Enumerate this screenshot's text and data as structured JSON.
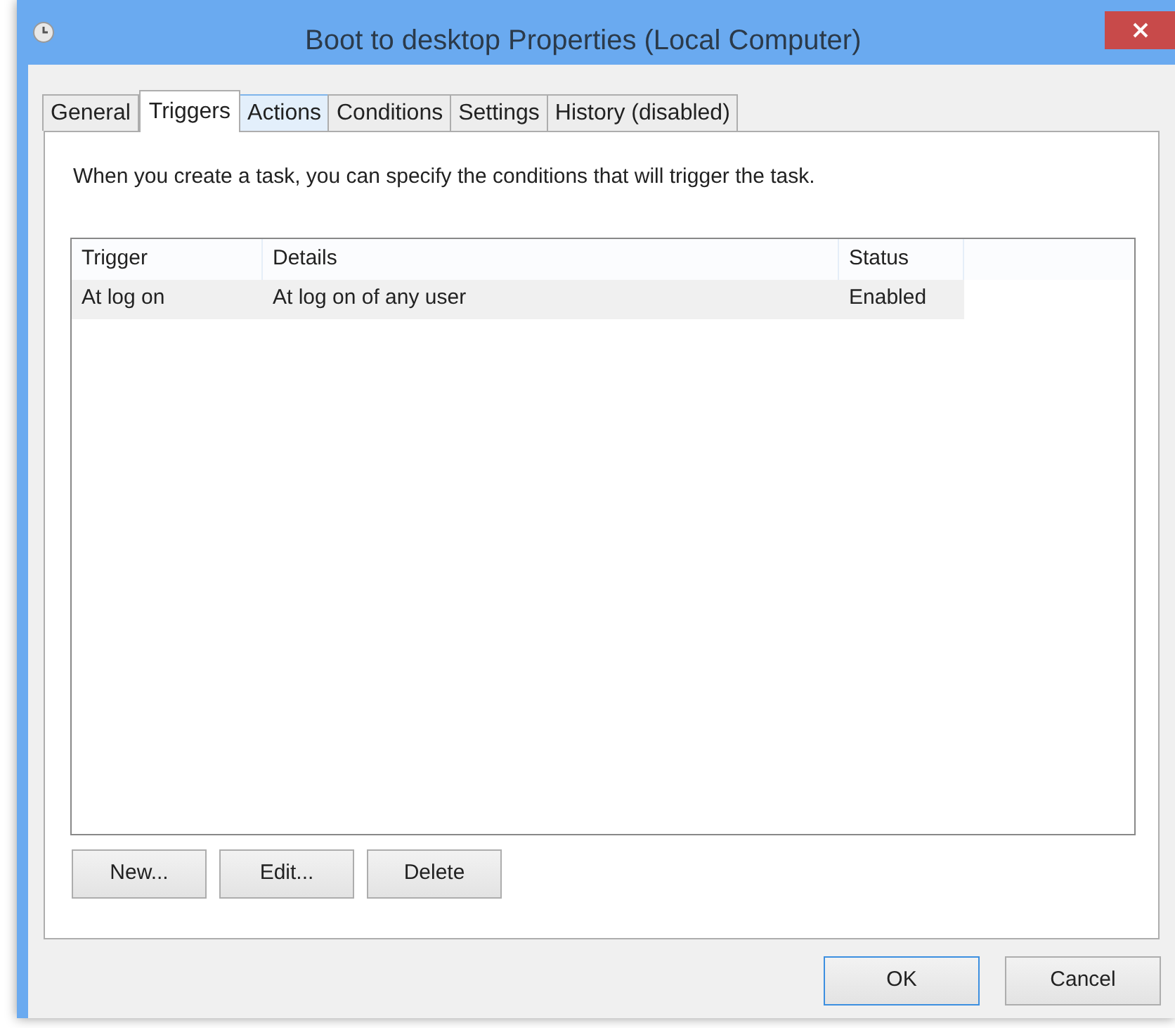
{
  "window": {
    "title": "Boot to desktop Properties (Local Computer)"
  },
  "tabs": [
    {
      "label": "General",
      "selected": false,
      "hovered": false
    },
    {
      "label": "Triggers",
      "selected": true,
      "hovered": false
    },
    {
      "label": "Actions",
      "selected": false,
      "hovered": true
    },
    {
      "label": "Conditions",
      "selected": false,
      "hovered": false
    },
    {
      "label": "Settings",
      "selected": false,
      "hovered": false
    },
    {
      "label": "History (disabled)",
      "selected": false,
      "hovered": false
    }
  ],
  "description": "When you create a task, you can specify the conditions that will trigger the task.",
  "table": {
    "columns": [
      "Trigger",
      "Details",
      "Status"
    ],
    "rows": [
      {
        "cells": [
          "At log on",
          "At log on of any user",
          "Enabled"
        ],
        "selected": true
      }
    ]
  },
  "list_buttons": [
    "New...",
    "Edit...",
    "Delete"
  ],
  "dialog_buttons": [
    {
      "label": "OK",
      "default": true
    },
    {
      "label": "Cancel",
      "default": false
    }
  ]
}
